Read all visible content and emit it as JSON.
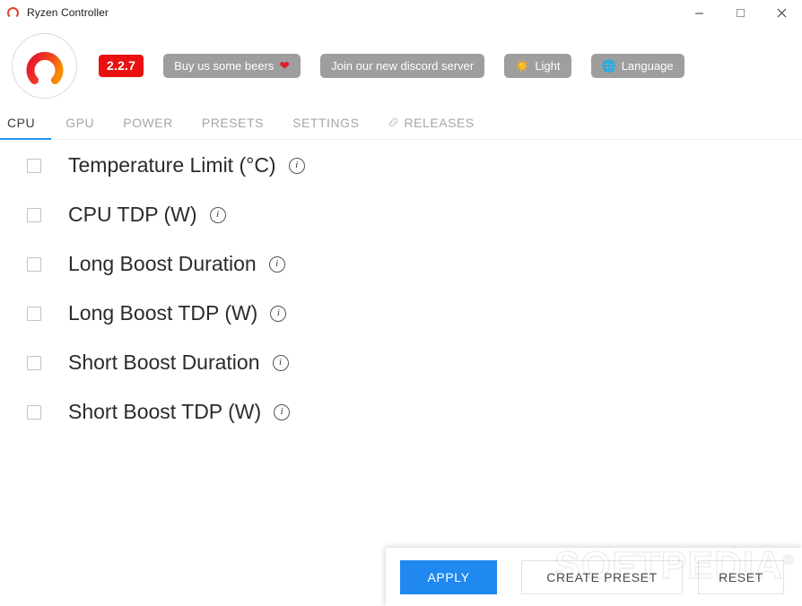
{
  "window": {
    "title": "Ryzen Controller",
    "app_icon": "ryzen-logo-icon",
    "minimize_label": "–",
    "maximize_label": "□",
    "close_label": "✕"
  },
  "header": {
    "logo_icon": "ryzen-controller-logo",
    "version": "2.2.7",
    "buttons": [
      {
        "id": "donate",
        "label": "Buy us some beers",
        "icon": "heart-icon",
        "glyph": "❤"
      },
      {
        "id": "discord",
        "label": "Join our new discord server",
        "icon": "",
        "glyph": ""
      },
      {
        "id": "theme",
        "label": "Light",
        "icon": "sun-icon",
        "glyph": "☀️"
      },
      {
        "id": "language",
        "label": "Language",
        "icon": "globe-icon",
        "glyph": "🌐"
      }
    ]
  },
  "tabs": [
    {
      "id": "cpu",
      "label": "CPU",
      "active": true,
      "icon": ""
    },
    {
      "id": "gpu",
      "label": "GPU",
      "active": false,
      "icon": ""
    },
    {
      "id": "power",
      "label": "POWER",
      "active": false,
      "icon": ""
    },
    {
      "id": "presets",
      "label": "PRESETS",
      "active": false,
      "icon": ""
    },
    {
      "id": "settings",
      "label": "SETTINGS",
      "active": false,
      "icon": ""
    },
    {
      "id": "releases",
      "label": "RELEASES",
      "active": false,
      "icon": "link-icon"
    }
  ],
  "settings_rows": [
    {
      "id": "temperature-limit",
      "label": "Temperature Limit (°C)",
      "checked": false,
      "info": "i"
    },
    {
      "id": "cpu-tdp",
      "label": "CPU TDP (W)",
      "checked": false,
      "info": "i"
    },
    {
      "id": "long-boost-duration",
      "label": "Long Boost Duration",
      "checked": false,
      "info": "i"
    },
    {
      "id": "long-boost-tdp",
      "label": "Long Boost TDP (W)",
      "checked": false,
      "info": "i"
    },
    {
      "id": "short-boost-duration",
      "label": "Short Boost Duration",
      "checked": false,
      "info": "i"
    },
    {
      "id": "short-boost-tdp",
      "label": "Short Boost TDP (W)",
      "checked": false,
      "info": "i"
    }
  ],
  "actions": {
    "apply_label": "APPLY",
    "create_preset_label": "CREATE PRESET",
    "reset_label": "RESET"
  },
  "watermark": {
    "text": "SOFTPEDIA",
    "mark": "®"
  },
  "colors": {
    "accent_blue": "#2089f0",
    "tab_underline": "#2196f3",
    "version_red": "#ea1010",
    "button_gray": "#9e9e9e",
    "heart_red": "#e8192c",
    "logo_red": "#e8192c",
    "logo_orange": "#f97316"
  }
}
